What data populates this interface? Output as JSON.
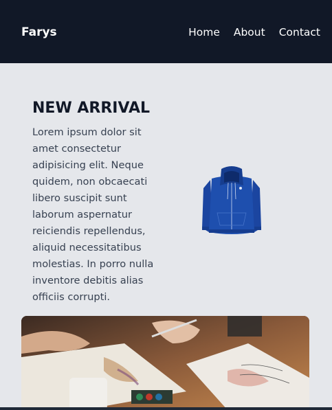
{
  "navbar": {
    "brand": "Farys",
    "links": [
      "Home",
      "About",
      "Contact"
    ]
  },
  "hero": {
    "title": "NEW ARRIVAL",
    "description": "Lorem ipsum dolor sit amet consectetur adipisicing elit. Neque quidem, non obcaecati libero suscipit sunt laborum aspernatur reiciendis repellendus, aliquid necessitatibus molestias. In porro nulla inventore debitis alias officiis corrupti.",
    "product_image": "blue-hoodie-image"
  },
  "feature_image": "art-supplies-photo",
  "colors": {
    "navbar": "#111827",
    "page_background": "#e5e7eb",
    "hoodie_blue": "#1e4fae"
  }
}
